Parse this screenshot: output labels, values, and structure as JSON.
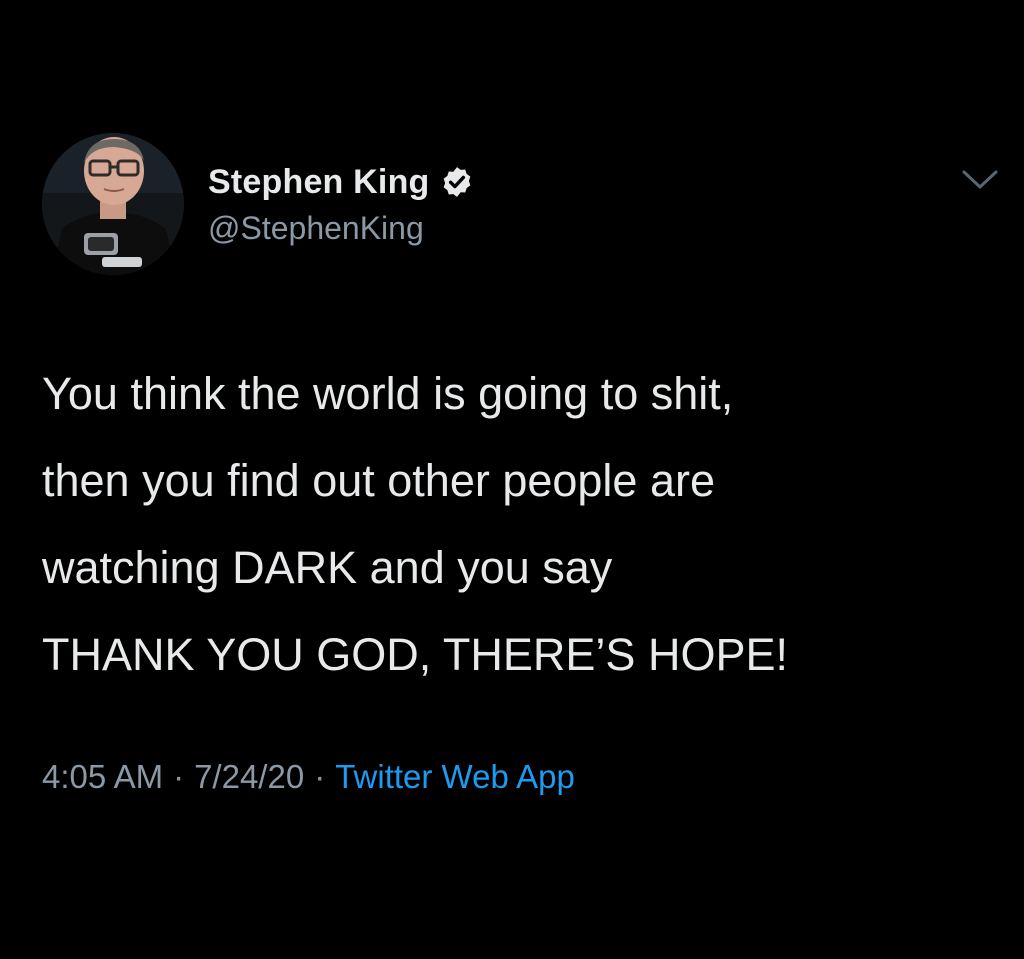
{
  "author": {
    "display_name": "Stephen King",
    "handle": "@StephenKing",
    "verified": true,
    "avatar_icon": "profile-photo"
  },
  "tweet": {
    "lines": [
      "You think the world is going to shit,",
      "then you find out other people are",
      "watching DARK and you say",
      "THANK YOU GOD, THERE’S HOPE!"
    ]
  },
  "meta": {
    "time": "4:05 AM",
    "date": "7/24/20",
    "separator": "·",
    "source": "Twitter Web App"
  },
  "icons": {
    "verified": "verified-badge-icon",
    "menu": "chevron-down-icon"
  },
  "colors": {
    "background": "#000000",
    "text": "#e7e9ea",
    "secondary": "#8b98a5",
    "link": "#1d9bf0"
  }
}
